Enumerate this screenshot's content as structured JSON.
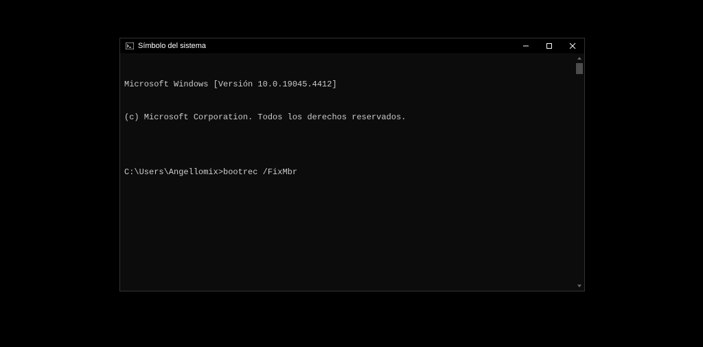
{
  "window": {
    "title": "Símbolo del sistema"
  },
  "terminal": {
    "lines": [
      "Microsoft Windows [Versión 10.0.19045.4412]",
      "(c) Microsoft Corporation. Todos los derechos reservados.",
      "",
      "C:\\Users\\Angellomix>bootrec /FixMbr"
    ]
  }
}
